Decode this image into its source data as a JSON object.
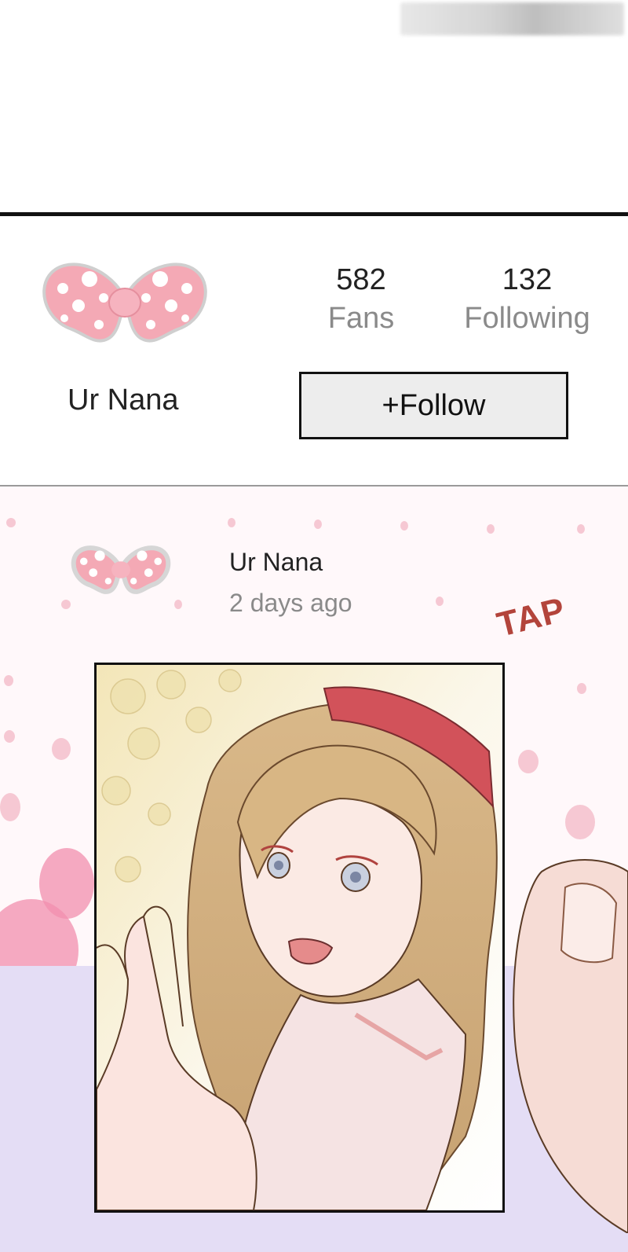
{
  "profile": {
    "username": "Ur Nana",
    "fans_count": "582",
    "fans_label": "Fans",
    "following_count": "132",
    "following_label": "Following",
    "follow_button": "+Follow"
  },
  "post": {
    "author": "Ur Nana",
    "time": "2 days ago",
    "sound_effect": "TAP"
  },
  "colors": {
    "bow_pink": "#f4a9b5",
    "accent_red": "#b3443b",
    "background_pink": "#fff8fa"
  },
  "icons": [
    "bow-avatar-icon",
    "bow-avatar-small-icon"
  ]
}
